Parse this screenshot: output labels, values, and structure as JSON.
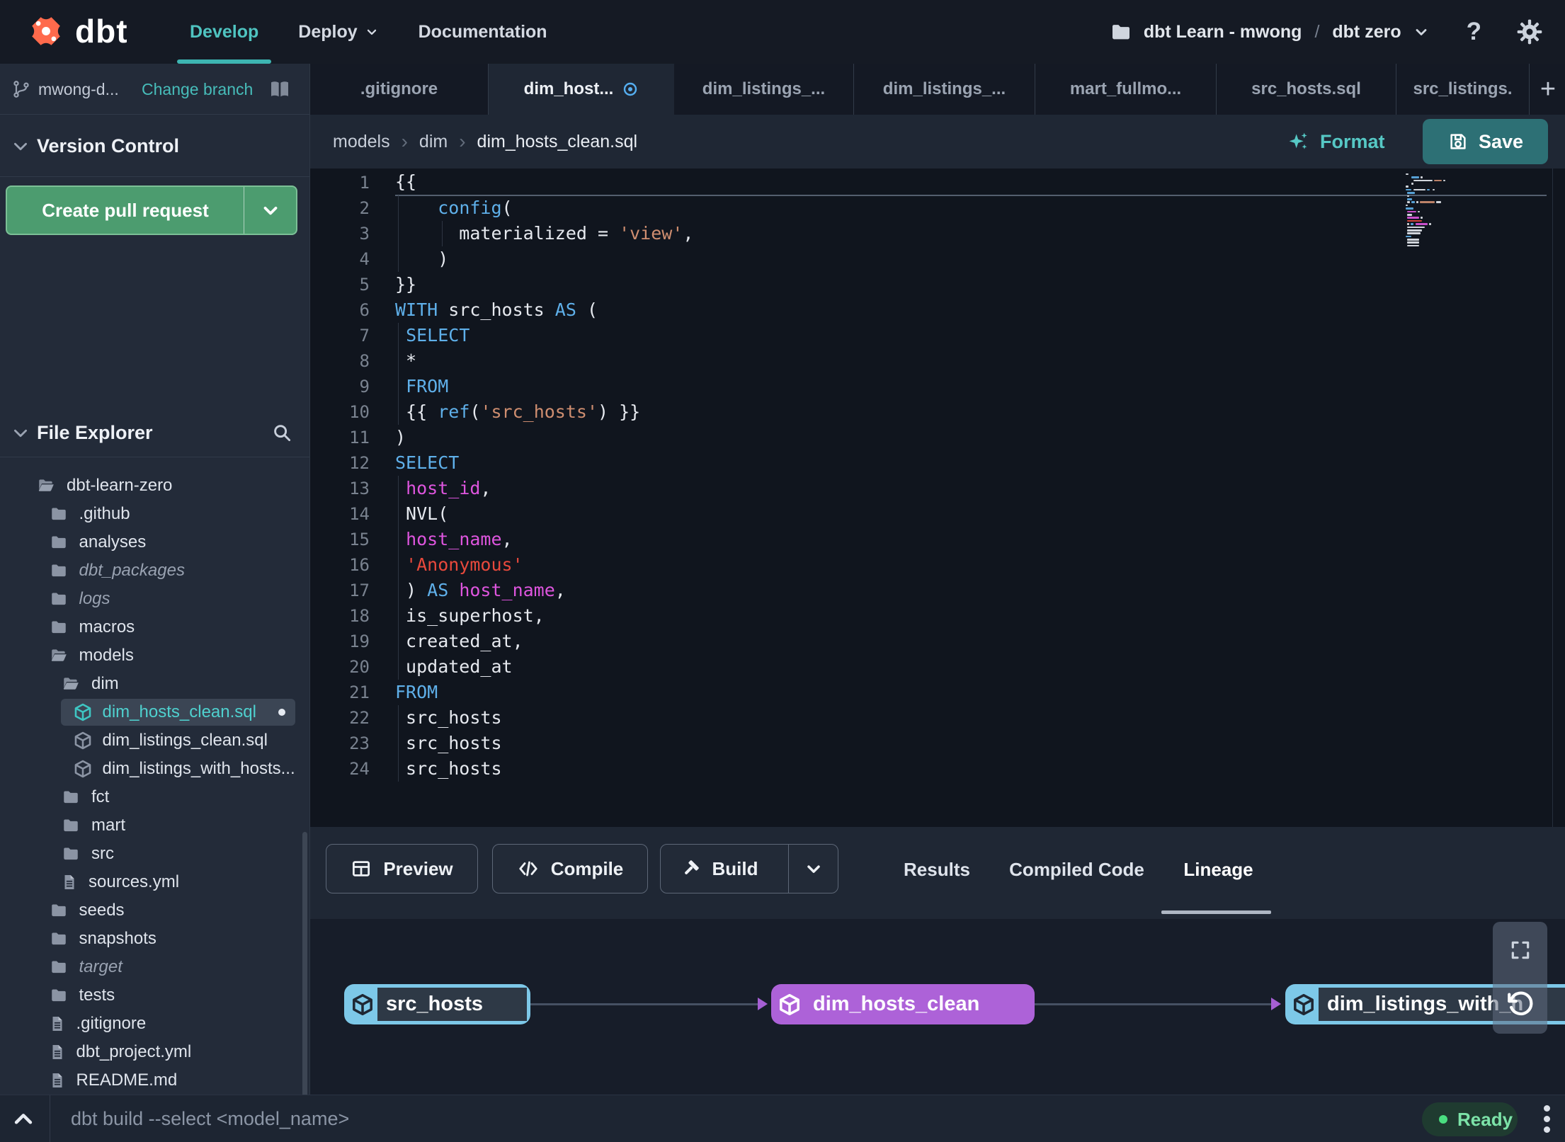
{
  "topnav": {
    "logo": "dbt",
    "items": [
      {
        "label": "Develop",
        "active": true,
        "caret": false
      },
      {
        "label": "Deploy",
        "active": false,
        "caret": true
      },
      {
        "label": "Documentation",
        "active": false,
        "caret": false
      }
    ],
    "account": "dbt Learn - mwong",
    "separator": "/",
    "project": "dbt zero"
  },
  "sidebar": {
    "branch": {
      "name": "mwong-d...",
      "action": "Change branch"
    },
    "version_control": {
      "label": "Version Control"
    },
    "create_pr": {
      "label": "Create pull request"
    },
    "file_explorer": {
      "label": "File Explorer"
    },
    "tree": [
      {
        "label": "dbt-learn-zero",
        "type": "folder-open",
        "indent": 0
      },
      {
        "label": ".github",
        "type": "folder",
        "indent": 1
      },
      {
        "label": "analyses",
        "type": "folder",
        "indent": 1
      },
      {
        "label": "dbt_packages",
        "type": "folder",
        "indent": 1,
        "dim": true
      },
      {
        "label": "logs",
        "type": "folder",
        "indent": 1,
        "dim": true
      },
      {
        "label": "macros",
        "type": "folder",
        "indent": 1
      },
      {
        "label": "models",
        "type": "folder-open",
        "indent": 1
      },
      {
        "label": "dim",
        "type": "folder-open",
        "indent": 2
      },
      {
        "label": "dim_hosts_clean.sql",
        "type": "model",
        "indent": 3,
        "selected": true,
        "unsaved": true
      },
      {
        "label": "dim_listings_clean.sql",
        "type": "model",
        "indent": 3
      },
      {
        "label": "dim_listings_with_hosts...",
        "type": "model",
        "indent": 3
      },
      {
        "label": "fct",
        "type": "folder",
        "indent": 2
      },
      {
        "label": "mart",
        "type": "folder",
        "indent": 2
      },
      {
        "label": "src",
        "type": "folder",
        "indent": 2
      },
      {
        "label": "sources.yml",
        "type": "file",
        "indent": 2
      },
      {
        "label": "seeds",
        "type": "folder",
        "indent": 1
      },
      {
        "label": "snapshots",
        "type": "folder",
        "indent": 1
      },
      {
        "label": "target",
        "type": "folder",
        "indent": 1,
        "dim": true
      },
      {
        "label": "tests",
        "type": "folder",
        "indent": 1
      },
      {
        "label": ".gitignore",
        "type": "file",
        "indent": 1
      },
      {
        "label": "dbt_project.yml",
        "type": "file",
        "indent": 1
      },
      {
        "label": "README.md",
        "type": "file",
        "indent": 1
      }
    ]
  },
  "tabs": {
    "items": [
      {
        "label": ".gitignore"
      },
      {
        "label": "dim_host...",
        "active": true,
        "modified": true
      },
      {
        "label": "dim_listings_..."
      },
      {
        "label": "dim_listings_..."
      },
      {
        "label": "mart_fullmo..."
      },
      {
        "label": "src_hosts.sql"
      },
      {
        "label": "src_listings."
      }
    ],
    "add_label": "+"
  },
  "breadcrumb": {
    "items": [
      "models",
      "dim",
      "dim_hosts_clean.sql"
    ]
  },
  "actions": {
    "format": "Format",
    "save": "Save"
  },
  "editor": {
    "token_colors": {
      "p": "#e6e9ef",
      "k": "#5fb0ea",
      "s": "#cf8e70",
      "r": "#e8493c",
      "i": "#de55de"
    },
    "lines": [
      {
        "n": 1,
        "seg": [
          [
            "{{",
            "p"
          ]
        ]
      },
      {
        "n": 2,
        "seg": [
          [
            "    ",
            "p"
          ],
          [
            "config",
            "k"
          ],
          [
            "(",
            "p"
          ]
        ]
      },
      {
        "n": 3,
        "seg": [
          [
            "      materialized = ",
            "p"
          ],
          [
            "'view'",
            "s"
          ],
          [
            ",",
            "p"
          ]
        ]
      },
      {
        "n": 4,
        "seg": [
          [
            "    )",
            "p"
          ]
        ]
      },
      {
        "n": 5,
        "seg": [
          [
            "}}",
            "p"
          ]
        ]
      },
      {
        "n": 6,
        "seg": [
          [
            "WITH",
            "k"
          ],
          [
            " src_hosts ",
            "p"
          ],
          [
            "AS",
            "k"
          ],
          [
            " (",
            "p"
          ]
        ]
      },
      {
        "n": 7,
        "seg": [
          [
            " ",
            "p"
          ],
          [
            "SELECT",
            "k"
          ]
        ]
      },
      {
        "n": 8,
        "seg": [
          [
            " *",
            "p"
          ]
        ]
      },
      {
        "n": 9,
        "seg": [
          [
            " ",
            "p"
          ],
          [
            "FROM",
            "k"
          ]
        ]
      },
      {
        "n": 10,
        "seg": [
          [
            " {{ ",
            "p"
          ],
          [
            "ref",
            "k"
          ],
          [
            "(",
            "p"
          ],
          [
            "'src_hosts'",
            "s"
          ],
          [
            ") }}",
            "p"
          ]
        ]
      },
      {
        "n": 11,
        "seg": [
          [
            ")",
            "p"
          ]
        ]
      },
      {
        "n": 12,
        "seg": [
          [
            "SELECT",
            "k"
          ]
        ]
      },
      {
        "n": 13,
        "seg": [
          [
            " ",
            "p"
          ],
          [
            "host_id",
            "i"
          ],
          [
            ",",
            "p"
          ]
        ]
      },
      {
        "n": 14,
        "seg": [
          [
            " NVL(",
            "p"
          ]
        ]
      },
      {
        "n": 15,
        "seg": [
          [
            " ",
            "p"
          ],
          [
            "host_name",
            "i"
          ],
          [
            ",",
            "p"
          ]
        ]
      },
      {
        "n": 16,
        "seg": [
          [
            " ",
            "p"
          ],
          [
            "'Anonymous'",
            "r"
          ]
        ]
      },
      {
        "n": 17,
        "seg": [
          [
            " ) ",
            "p"
          ],
          [
            "AS",
            "k"
          ],
          [
            " ",
            "p"
          ],
          [
            "host_name",
            "i"
          ],
          [
            ",",
            "p"
          ]
        ]
      },
      {
        "n": 18,
        "seg": [
          [
            " is_superhost,",
            "p"
          ]
        ]
      },
      {
        "n": 19,
        "seg": [
          [
            " created_at,",
            "p"
          ]
        ]
      },
      {
        "n": 20,
        "seg": [
          [
            " updated_at",
            "p"
          ]
        ]
      },
      {
        "n": 21,
        "seg": [
          [
            "FROM",
            "k"
          ]
        ]
      },
      {
        "n": 22,
        "seg": [
          [
            " src_hosts",
            "p"
          ]
        ]
      },
      {
        "n": 23,
        "seg": [
          [
            " src_hosts",
            "p"
          ]
        ]
      },
      {
        "n": 24,
        "seg": [
          [
            " src_hosts",
            "p"
          ]
        ]
      }
    ]
  },
  "panel": {
    "buttons": [
      {
        "label": "Preview",
        "icon": "table-icon"
      },
      {
        "label": "Compile",
        "icon": "code-icon"
      },
      {
        "label": "Build",
        "icon": "hammer-icon",
        "split": true
      }
    ],
    "tabs": [
      {
        "label": "Results"
      },
      {
        "label": "Compiled Code"
      },
      {
        "label": "Lineage",
        "active": true
      }
    ]
  },
  "lineage": {
    "nodes": [
      {
        "label": "src_hosts",
        "variant": "outlined",
        "accent": "#7dc8e8"
      },
      {
        "label": "dim_hosts_clean",
        "variant": "filled",
        "accent": "#ad62d8"
      },
      {
        "label": "dim_listings_with_h",
        "variant": "outlined",
        "accent": "#7dc8e8"
      }
    ]
  },
  "statusbar": {
    "command_placeholder": "dbt build --select <model_name>",
    "status": {
      "label": "Ready",
      "color": "#4ade80"
    }
  },
  "colors": {
    "accent_teal": "#3db5b2",
    "green_button": "#4c9c6f",
    "save_teal": "#2d7075",
    "modified_blue": "#55aef0",
    "lineage_purple": "#ad62d8",
    "lineage_cyan": "#7dc8e8",
    "ready_green": "#4ade80",
    "logo_orange": "#ff6a4c"
  }
}
